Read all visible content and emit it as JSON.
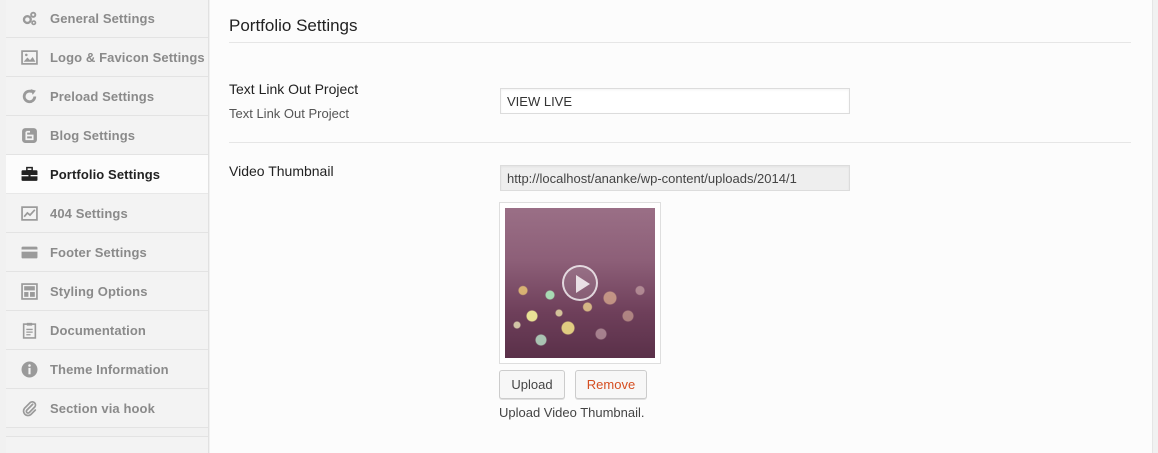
{
  "sidebar": {
    "items": [
      {
        "label": "General Settings",
        "icon": "gears-icon",
        "active": false
      },
      {
        "label": "Logo & Favicon Settings",
        "icon": "image-icon",
        "active": false
      },
      {
        "label": "Preload Settings",
        "icon": "refresh-icon",
        "active": false
      },
      {
        "label": "Blog Settings",
        "icon": "blogger-icon",
        "active": false
      },
      {
        "label": "Portfolio Settings",
        "icon": "briefcase-icon",
        "active": true
      },
      {
        "label": "404 Settings",
        "icon": "chart-icon",
        "active": false
      },
      {
        "label": "Footer Settings",
        "icon": "credit-card-icon",
        "active": false
      },
      {
        "label": "Styling Options",
        "icon": "layout-icon",
        "active": false
      },
      {
        "label": "Documentation",
        "icon": "clipboard-icon",
        "active": false
      },
      {
        "label": "Theme Information",
        "icon": "info-icon",
        "active": false
      },
      {
        "label": "Section via hook",
        "icon": "paperclip-icon",
        "active": false
      }
    ]
  },
  "main": {
    "title": "Portfolio Settings",
    "text_link": {
      "label": "Text Link Out Project",
      "description": "Text Link Out Project",
      "value": "VIEW LIVE"
    },
    "video_thumbnail": {
      "label": "Video Thumbnail",
      "url": "http://localhost/ananke/wp-content/uploads/2014/1",
      "upload_label": "Upload",
      "remove_label": "Remove",
      "helper": "Upload Video Thumbnail."
    }
  },
  "colors": {
    "remove_text": "#d54e21",
    "active_sidebar_bg": "#fcfcfc",
    "sidebar_bg": "#f3f3f3"
  }
}
